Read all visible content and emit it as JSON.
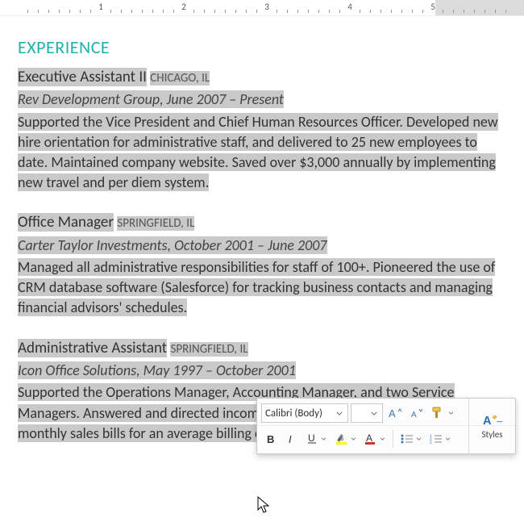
{
  "heading": "EXPERIENCE",
  "jobs": [
    {
      "title": "Executive Assistant II",
      "loc": "CHICAGO, IL",
      "company": "Rev Development Group, June 2007 – Present",
      "desc": "Supported the Vice President and Chief Human Resources Officer. Developed new hire orientation for administrative staff, and delivered to 25 new employees to date. Maintained company website. Saved over $3,000 annually by implementing new travel and per diem system."
    },
    {
      "title": "Office Manager",
      "loc": "SPRINGFIELD, IL",
      "company": "Carter Taylor Investments, October 2001 – June 2007",
      "desc": "Managed all administrative responsibilities for staff of 100+. Pioneered the use of CRM database software (Salesforce) for tracking business contacts and managing financial advisors' schedules."
    },
    {
      "title": "Administrative Assistant",
      "loc": "SPRINGFIELD, IL",
      "company": "Icon Office Solutions, May 1997 – October 2001",
      "desc": "Supported the Operations Manager, Accounting Manager, and two Service Managers. Answered and directed incoming calls for six phone lines. Processed monthly sales bills for an average billing cycle of $350,000+."
    }
  ],
  "toolbar": {
    "font_name": "Calibri (Body)",
    "font_size": "",
    "styles_label": "Styles"
  },
  "ruler": {
    "labels": [
      "1",
      "2",
      "3",
      "4",
      "5"
    ]
  }
}
